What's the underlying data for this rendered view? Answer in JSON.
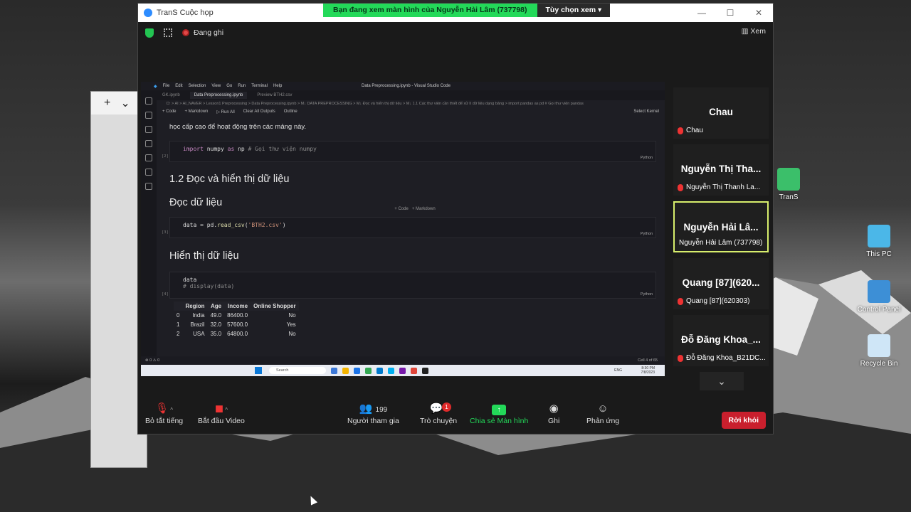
{
  "window": {
    "title": "TranS Cuộc họp",
    "share_banner": "Bạn đang xem màn hình của Nguyễn Hải Lâm (737798)",
    "view_options": "Tùy chọn xem",
    "recording": "Đang ghi",
    "view": "Xem"
  },
  "vscode": {
    "title": "Data Preprocessing.ipynb - Visual Studio Code",
    "menu": [
      "File",
      "Edit",
      "Selection",
      "View",
      "Go",
      "Run",
      "Terminal",
      "Help"
    ],
    "tabs": [
      "GK.ipynb",
      "Data Preprocessing.ipynb",
      "Preview BTH2.csv"
    ],
    "breadcrumb": "D: > AI > AI_NAVER > Lesson1 Preprocessing > Data Preprocessing.ipynb > M↓ DATA PREPROCESSING > M↓ Đọc và hiển thị dữ liệu > M↓ 1.1 Các thư viện cần thiết để xử lí dữ liệu dạng bảng > import pandas as pd # Gọi thư viện pandas",
    "toolbar": [
      "+ Code",
      "+ Markdown",
      "▷ Run All",
      "Clear All Outputs",
      "Outline"
    ],
    "select_kernel": "Select Kernel",
    "intro_text": "học cấp cao để hoạt động trên các mảng này.",
    "cell2_code": [
      "import",
      " numpy ",
      "as",
      " np ",
      "# Gọi thư viện numpy"
    ],
    "heading_1_2": "1.2 Đọc và hiển thị dữ liệu",
    "heading_read": "Đọc dữ liệu",
    "add_code": "+ Code",
    "add_md": "+ Markdown",
    "cell3_code": [
      "data = pd.",
      "read_csv",
      "(",
      "'BTH2.csv'",
      ")"
    ],
    "heading_show": "Hiển thị dữ liệu",
    "cell4_line1": "data",
    "cell4_line2": "# display(data)",
    "python_label": "Python",
    "cell_nums": [
      "[2]",
      "[3]",
      "[4]"
    ],
    "table": {
      "headers": [
        "",
        "Region",
        "Age",
        "Income",
        "Online Shopper"
      ],
      "rows": [
        [
          "0",
          "India",
          "49.0",
          "86400.0",
          "No"
        ],
        [
          "1",
          "Brazil",
          "32.0",
          "57600.0",
          "Yes"
        ],
        [
          "2",
          "USA",
          "35.0",
          "64800.0",
          "No"
        ]
      ]
    },
    "status_left": "⊗ 0 ⚠ 0",
    "status_right": "Cell 4 of 65",
    "taskbar_search": "Search",
    "clock_time": "8:30 PM",
    "clock_date": "7/8/2023",
    "lang": "ENG"
  },
  "participants": [
    {
      "big": "Chau",
      "small": "Chau"
    },
    {
      "big": "Nguyễn Thị Tha...",
      "small": "Nguyễn Thị Thanh La..."
    },
    {
      "big": "Nguyễn Hải Lâ...",
      "small": "Nguyễn Hải Lâm (737798)"
    },
    {
      "big": "Quang [87](620...",
      "small": "Quang [87](620303)"
    },
    {
      "big": "Đỗ Đăng Khoa_...",
      "small": "Đỗ Đăng Khoa_B21DC..."
    }
  ],
  "toolbar": {
    "mute": "Bỏ tắt tiếng",
    "video": "Bắt đầu Video",
    "participants": "Người tham gia",
    "participants_count": "199",
    "chat": "Trò chuyện",
    "chat_badge": "1",
    "share": "Chia sẻ Màn hình",
    "record": "Ghi",
    "reactions": "Phản ứng",
    "leave": "Rời khỏi"
  },
  "desktop": {
    "icons": [
      "TranS",
      "This PC",
      "Control Panel",
      "Recycle Bin"
    ]
  }
}
